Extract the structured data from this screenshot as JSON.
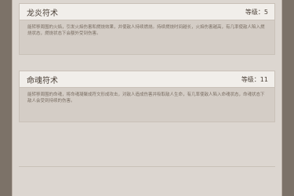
{
  "skills": [
    {
      "name": "龙炎符术",
      "level_text": "等级：5",
      "description": "能转移周围的火焰，引发火焰伤害和燃烧效果，并使敌人持续燃烧。持续燃烧时间越长，火焰伤害越高，有几率使敌人陷入燃烧状态，燃烧状态下会额外受到伤害。"
    },
    {
      "name": "命魂符术",
      "level_text": "等级：11",
      "description": "能转移周围的命魂，将命魂凝聚成符文形成攻击，对敌人造成伤害并吸取敌人生命，有几率使敌人陷入命魂状态，命魂状态下敌人会受到持续的伤害。"
    }
  ]
}
